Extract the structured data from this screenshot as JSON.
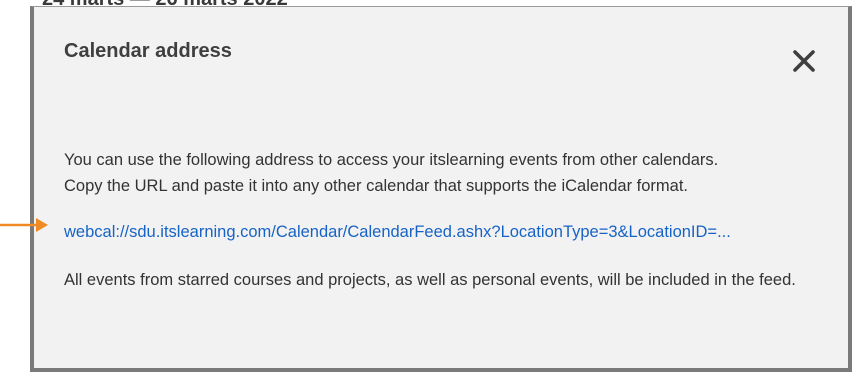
{
  "backdrop": {
    "partial_heading": "24 marts — 26 marts 2022"
  },
  "dialog": {
    "title": "Calendar address",
    "close_icon": "close-icon",
    "paragraph_1_line_1": "You can use the following address to access your itslearning events from other calendars.",
    "paragraph_1_line_2": "Copy the URL and paste it into any other calendar that supports the iCalendar format.",
    "feed_url": "webcal://sdu.itslearning.com/Calendar/CalendarFeed.ashx?LocationType=3&LocationID=...",
    "paragraph_2": "All events from starred courses and projects, as well as personal events, will be included in the feed."
  },
  "annotation": {
    "arrow_icon": "arrow-right-icon",
    "arrow_color": "#f08a24"
  },
  "colors": {
    "dialog_background": "#f2f2f2",
    "link": "#1763c5",
    "text": "#333333",
    "border": "#7a7a7a"
  }
}
